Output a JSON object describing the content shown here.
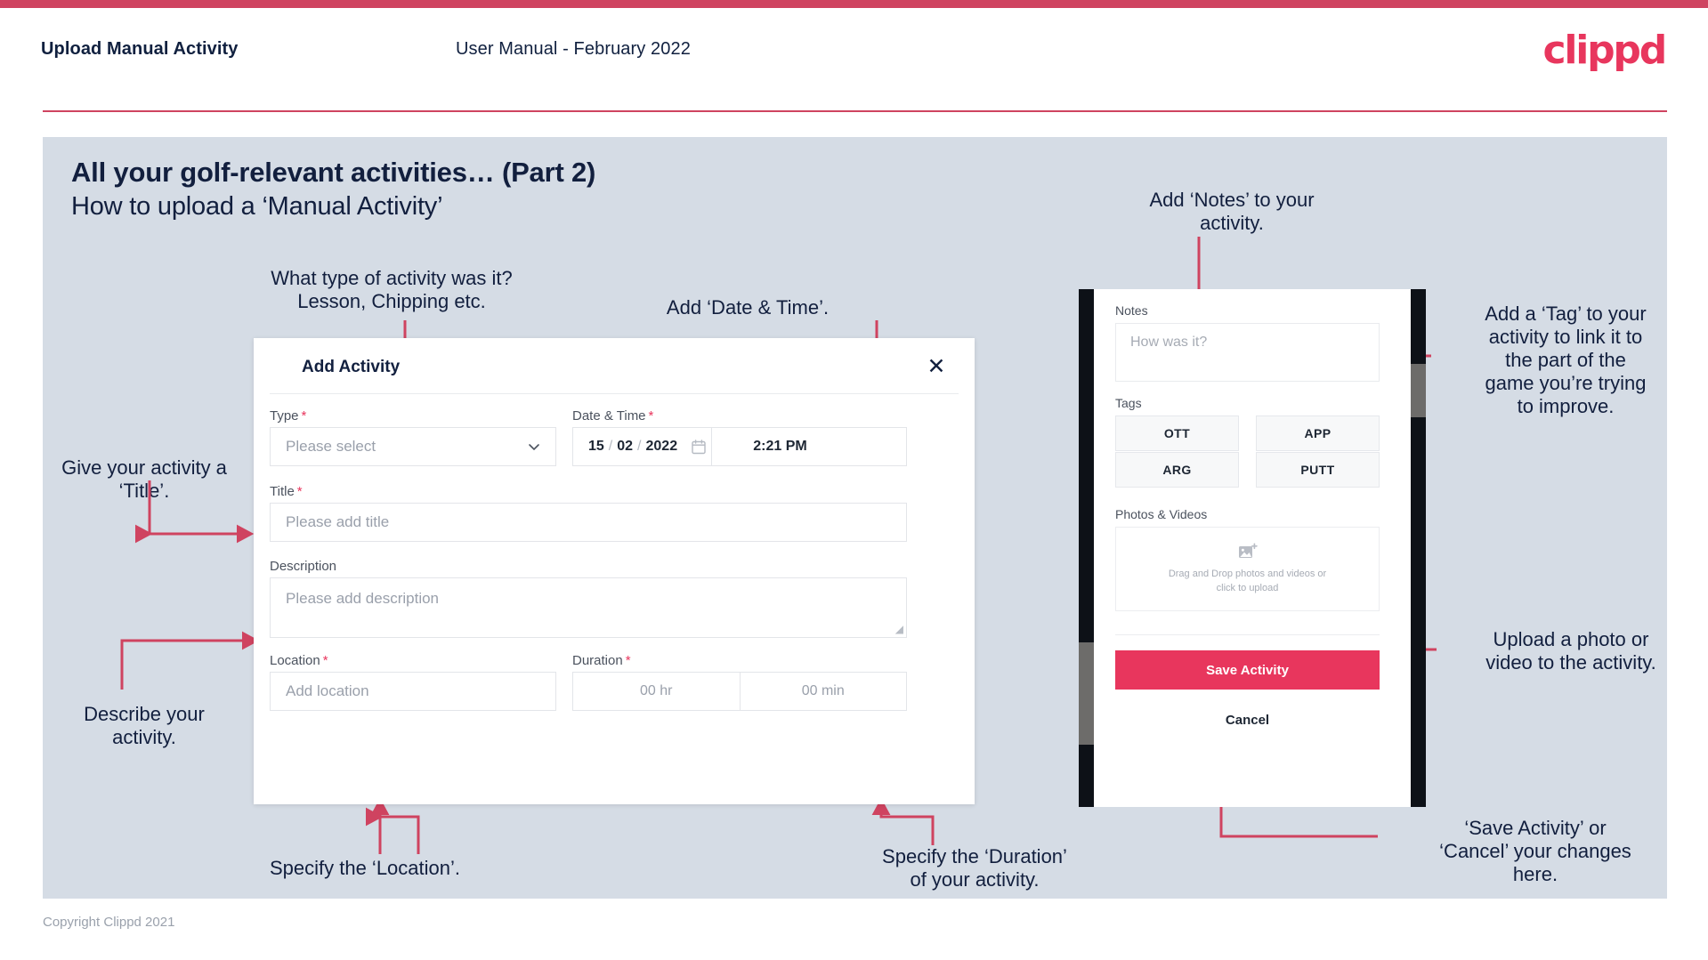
{
  "header": {
    "title": "Upload Manual Activity",
    "subtitle": "User Manual - February 2022",
    "logo": "clippd"
  },
  "slide": {
    "title": "All your golf-relevant activities… (Part 2)",
    "subtitle": "How to upload a ‘Manual Activity’"
  },
  "footer": {
    "copyright": "Copyright Clippd 2021"
  },
  "colors": {
    "brand_pink": "#e8365d",
    "top_bar": "#cf4360",
    "slide_bg": "#d5dce5",
    "ink": "#121f3e",
    "arrow": "#cf4360"
  },
  "modal": {
    "title": "Add Activity",
    "close_icon": "close-icon",
    "fields": {
      "type": {
        "label": "Type",
        "required": "*",
        "placeholder": "Please select"
      },
      "datetime": {
        "label": "Date & Time",
        "required": "*",
        "day": "15",
        "month": "02",
        "year": "2022",
        "sep": "/",
        "time": "2:21 PM",
        "calendar_icon": "calendar-icon"
      },
      "title": {
        "label": "Title",
        "required": "*",
        "placeholder": "Please add title"
      },
      "description": {
        "label": "Description",
        "placeholder": "Please add description"
      },
      "location": {
        "label": "Location",
        "required": "*",
        "placeholder": "Add location"
      },
      "duration": {
        "label": "Duration",
        "required": "*",
        "hours": "00 hr",
        "minutes": "00 min"
      }
    }
  },
  "phone": {
    "notes": {
      "label": "Notes",
      "placeholder": "How was it?"
    },
    "tags": {
      "label": "Tags",
      "items": [
        "OTT",
        "APP",
        "ARG",
        "PUTT"
      ]
    },
    "photos": {
      "label": "Photos & Videos",
      "icon": "add-image-icon",
      "drop_line1": "Drag and Drop photos and videos or",
      "drop_line2": "click to upload"
    },
    "save_label": "Save Activity",
    "cancel_label": "Cancel"
  },
  "annotations": {
    "type": "What type of activity was it?\nLesson, Chipping etc.",
    "datetime": "Add ‘Date & Time’.",
    "notes": "Add ‘Notes’ to your\nactivity.",
    "tag": "Add a ‘Tag’ to your\nactivity to link it to\nthe part of the\ngame you’re trying\nto improve.",
    "title": "Give your activity a\n‘Title’.",
    "description": "Describe your\nactivity.",
    "location": "Specify the ‘Location’.",
    "duration": "Specify the ‘Duration’\nof your activity.",
    "upload": "Upload a photo or\nvideo to the activity.",
    "savecancel": "‘Save Activity’ or\n‘Cancel’ your changes\nhere."
  }
}
